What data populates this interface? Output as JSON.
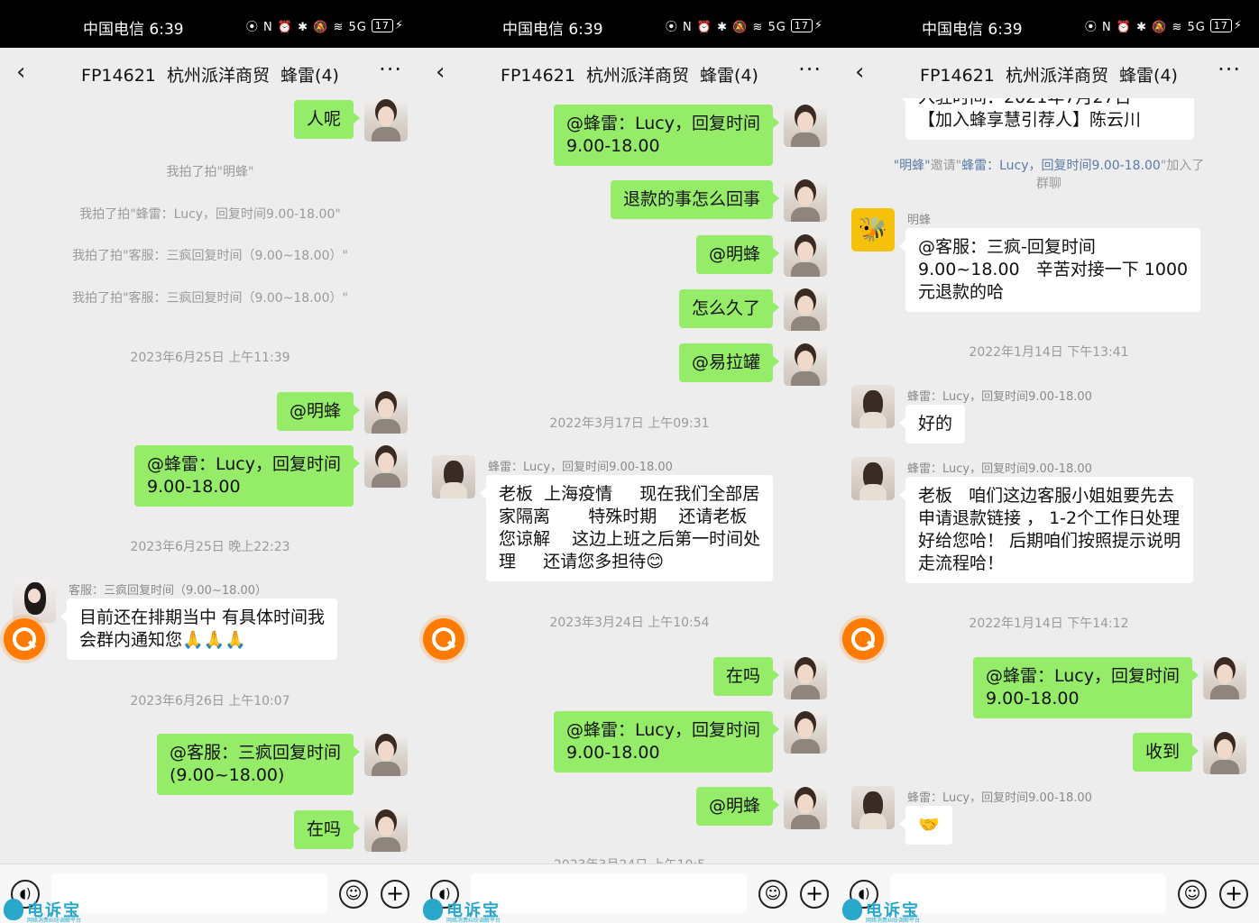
{
  "status": {
    "carrier": "中国电信 6:39",
    "icons": "⦿ N ⏰ ✱ 🔕 ≋ 5G",
    "battery": "17"
  },
  "header": {
    "back_icon": "‹",
    "title": "FP14621  杭州派洋商贸  蜂雷(4)",
    "more_icon": "···"
  },
  "watermark": {
    "brand": "电诉宝",
    "tagline": "网络消费纠纷调解平台"
  },
  "panel1": {
    "m_renne": "人呢",
    "pat1": "我拍了拍\"明蜂\"",
    "pat2": "我拍了拍\"蜂雷：Lucy，回复时间9.00-18.00\"",
    "pat3": "我拍了拍\"客服：三疯回复时间（9.00~18.00）\"",
    "pat4": "我拍了拍\"客服：三疯回复时间（9.00~18.00）\"",
    "t1": "2023年6月25日 上午11:39",
    "m_mf": "@明蜂",
    "m_fl_1": "@蜂雷：Lucy，回复时间",
    "m_fl_2": "9.00-18.00",
    "t2": "2023年6月25日 晚上22:23",
    "kf_sender": "客服：三疯回复时间（9.00~18.00）",
    "kf_msg_1": "目前还在排期当中 有具体时间我",
    "kf_msg_2": "会群内通知您🙏🙏🙏",
    "t3": "2023年6月26日 上午10:07",
    "m_kf_1": "@客服：三疯回复时间",
    "m_kf_2": "(9.00~18.00)",
    "m_zaima": "在吗"
  },
  "panel2": {
    "m_fl_1": "@蜂雷：Lucy，回复时间",
    "m_fl_2": "9.00-18.00",
    "m_refund": "退款的事怎么回事",
    "m_mf": "@明蜂",
    "m_long": "怎么久了",
    "m_ylg": "@易拉罐",
    "t1": "2022年3月17日 上午09:31",
    "fl_sender": "蜂雷：Lucy，回复时间9.00-18.00",
    "fl_msg_1": "老板  上海疫情     现在我们全部居",
    "fl_msg_2": "家隔离       特殊时期    还请老板",
    "fl_msg_3": "您谅解    这边上班之后第一时间处",
    "fl_msg_4": "理     还请您多担待😊",
    "t2": "2023年3月24日 上午10:54",
    "m_zaima": "在吗",
    "m_fl2_1": "@蜂雷：Lucy，回复时间",
    "m_fl2_2": "9.00-18.00",
    "m_mf2": "@明蜂",
    "t3_partial": "2023年3月24日 上午10:5"
  },
  "panel3": {
    "top_cut_1": "入驻时间：2021年7月27日",
    "top_cut_2": "【加入蜂享慧引荐人】陈云川",
    "invite_a": "\"明蜂\"",
    "invite_b": "邀请\"",
    "invite_c": "蜂雷：Lucy，回复时间9.00-18.00",
    "invite_d": "\"加入了",
    "invite_e": "群聊",
    "mf_sender": "明蜂",
    "mf_msg_1": "@客服：三疯-回复时间",
    "mf_msg_2": "9.00~18.00   辛苦对接一下 1000",
    "mf_msg_3": "元退款的哈",
    "t1": "2022年1月14日 下午13:41",
    "fl_sender": "蜂雷：Lucy，回复时间9.00-18.00",
    "fl_ok": "好的",
    "fl_sender2": "蜂雷：Lucy，回复时间9.00-18.00",
    "fl_msg_1": "老板   咱们这边客服小姐姐要先去",
    "fl_msg_2": "申请退款链接 ， 1-2个工作日处理",
    "fl_msg_3": "好给您哈！ 后期咱们按照提示说明",
    "fl_msg_4": "走流程哈！",
    "t2": "2022年1月14日 下午14:12",
    "m_fl_1": "@蜂雷：Lucy，回复时间",
    "m_fl_2": "9.00-18.00",
    "m_received": "收到",
    "fl_sender3": "蜂雷：Lucy，回复时间9.00-18.00",
    "fl_shake": "🤝"
  }
}
